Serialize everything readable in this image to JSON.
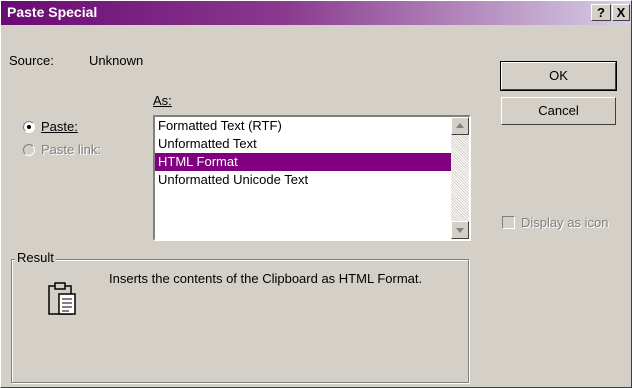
{
  "window": {
    "title": "Paste Special",
    "help_glyph": "?",
    "close_glyph": "X"
  },
  "source": {
    "label": "Source:",
    "value": "Unknown"
  },
  "as_label": "As:",
  "options": {
    "paste_label": "Paste:",
    "paste_link_label": "Paste link:",
    "selected": "paste"
  },
  "formats": [
    {
      "label": "Formatted Text (RTF)",
      "selected": false
    },
    {
      "label": "Unformatted Text",
      "selected": false
    },
    {
      "label": "HTML Format",
      "selected": true
    },
    {
      "label": "Unformatted Unicode Text",
      "selected": false
    }
  ],
  "buttons": {
    "ok": "OK",
    "cancel": "Cancel"
  },
  "display_as_icon": {
    "label": "Display as icon",
    "checked": false,
    "enabled": false
  },
  "result": {
    "label": "Result",
    "description": "Inserts the contents of the Clipboard as HTML Format.",
    "icon": "clipboard-icon"
  },
  "colors": {
    "selection": "#800080",
    "titlebar_start": "#6a0a74",
    "titlebar_end": "#d8cfe6",
    "face": "#d4d0c8"
  }
}
